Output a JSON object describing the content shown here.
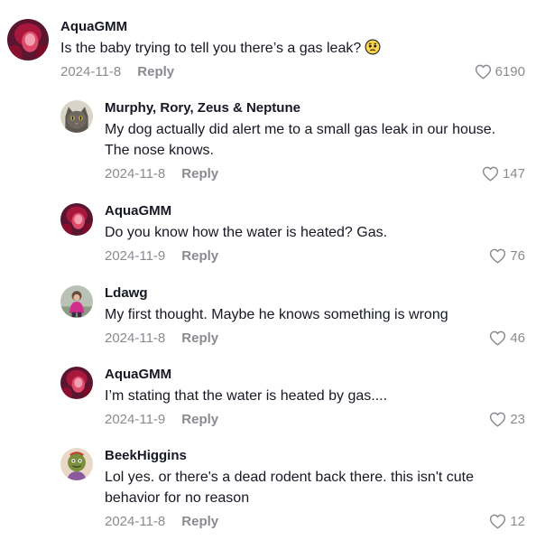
{
  "comments": [
    {
      "username": "AquaGMM",
      "text": "Is the baby trying to tell you there’s a gas leak?",
      "emoji": "worried-face-emoji",
      "date": "2024-11-8",
      "reply_label": "Reply",
      "likes": "6190",
      "avatar": "aquagmm-avatar"
    },
    {
      "username": "Murphy, Rory, Zeus & Neptune",
      "text": "My dog actually did alert me to a small gas leak in our house. The nose knows.",
      "date": "2024-11-8",
      "reply_label": "Reply",
      "likes": "147",
      "avatar": "cat-avatar"
    },
    {
      "username": "AquaGMM",
      "text": "Do you know how the water is heated? Gas.",
      "date": "2024-11-9",
      "reply_label": "Reply",
      "likes": "76",
      "avatar": "aquagmm-avatar"
    },
    {
      "username": "Ldawg",
      "text": "My first thought. Maybe he knows something is wrong",
      "date": "2024-11-8",
      "reply_label": "Reply",
      "likes": "46",
      "avatar": "ldawg-avatar"
    },
    {
      "username": "AquaGMM",
      "text": "I’m stating that the water is heated by gas....",
      "date": "2024-11-9",
      "reply_label": "Reply",
      "likes": "23",
      "avatar": "aquagmm-avatar"
    },
    {
      "username": "BeekHiggins",
      "text": "Lol yes. or there's a dead rodent back there. this isn't cute behavior for no reason",
      "date": "2024-11-8",
      "reply_label": "Reply",
      "likes": "12",
      "avatar": "beekhiggins-avatar"
    }
  ],
  "colors": {
    "text": "#161823",
    "muted": "#8a8b91"
  }
}
